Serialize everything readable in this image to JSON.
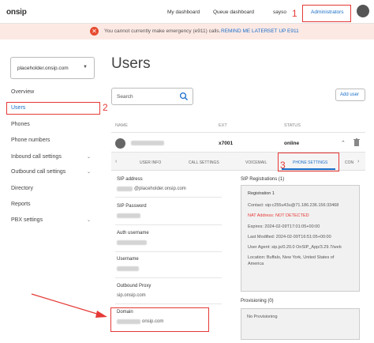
{
  "topbar": {
    "logo": "onsip",
    "nav": [
      "My dashboard",
      "Queue dashboard",
      "sayso"
    ],
    "admin_label": "Administrators"
  },
  "annotations": [
    "1",
    "2",
    "3"
  ],
  "alert": {
    "text": "You cannot currently make emergency (e911) calls.",
    "remind_label": "REMIND ME LATER",
    "setup_label": "SET UP E911"
  },
  "sidebar": {
    "domain": "placeholder.onsip.com",
    "items": [
      {
        "label": "Overview"
      },
      {
        "label": "Users"
      },
      {
        "label": "Phones"
      },
      {
        "label": "Phone numbers"
      },
      {
        "label": "Inbound call settings"
      },
      {
        "label": "Outbound call settings"
      },
      {
        "label": "Directory"
      },
      {
        "label": "Reports"
      },
      {
        "label": "PBX settings"
      }
    ]
  },
  "main": {
    "title": "Users",
    "search_placeholder": "Search",
    "add_user_label": "Add user",
    "columns": [
      "NAME",
      "EXT",
      "STATUS"
    ],
    "row": {
      "ext": "x7001",
      "status": "online"
    },
    "tabs": [
      "USER INFO",
      "CALL SETTINGS",
      "VOICEMAIL",
      "PHONE SETTINGS",
      "CON"
    ],
    "fields": [
      {
        "label": "SIP address",
        "value": "@placeholder.onsip.com"
      },
      {
        "label": "SIP Password",
        "value": ""
      },
      {
        "label": "Auth username",
        "value": ""
      },
      {
        "label": "Username",
        "value": ""
      },
      {
        "label": "Outbound Proxy",
        "value": "sip.onsip.com"
      },
      {
        "label": "Domain",
        "value": "onsip.com"
      }
    ],
    "registrations": {
      "title": "SIP Registrations (1)",
      "heading": "Registration 1",
      "contact": "Contact: sip:c255u43u@71.186.236.156:33468",
      "nat": "NAT Address: NOT DETECTED",
      "expires": "Expires: 2024-02-09T17:01:05+00:00",
      "last_modified": "Last Modified: 2024-02-09T16:51:05+00:00",
      "user_agent_1": "User Agent: sip.js/0.20.0 OnSIP_App/3.29.7/web",
      "location_1": "Location: Buffalo, New York, United States of",
      "location_2": "America"
    },
    "provisioning": {
      "title": "Provisioning (0)",
      "empty": "No Provisioning"
    }
  }
}
